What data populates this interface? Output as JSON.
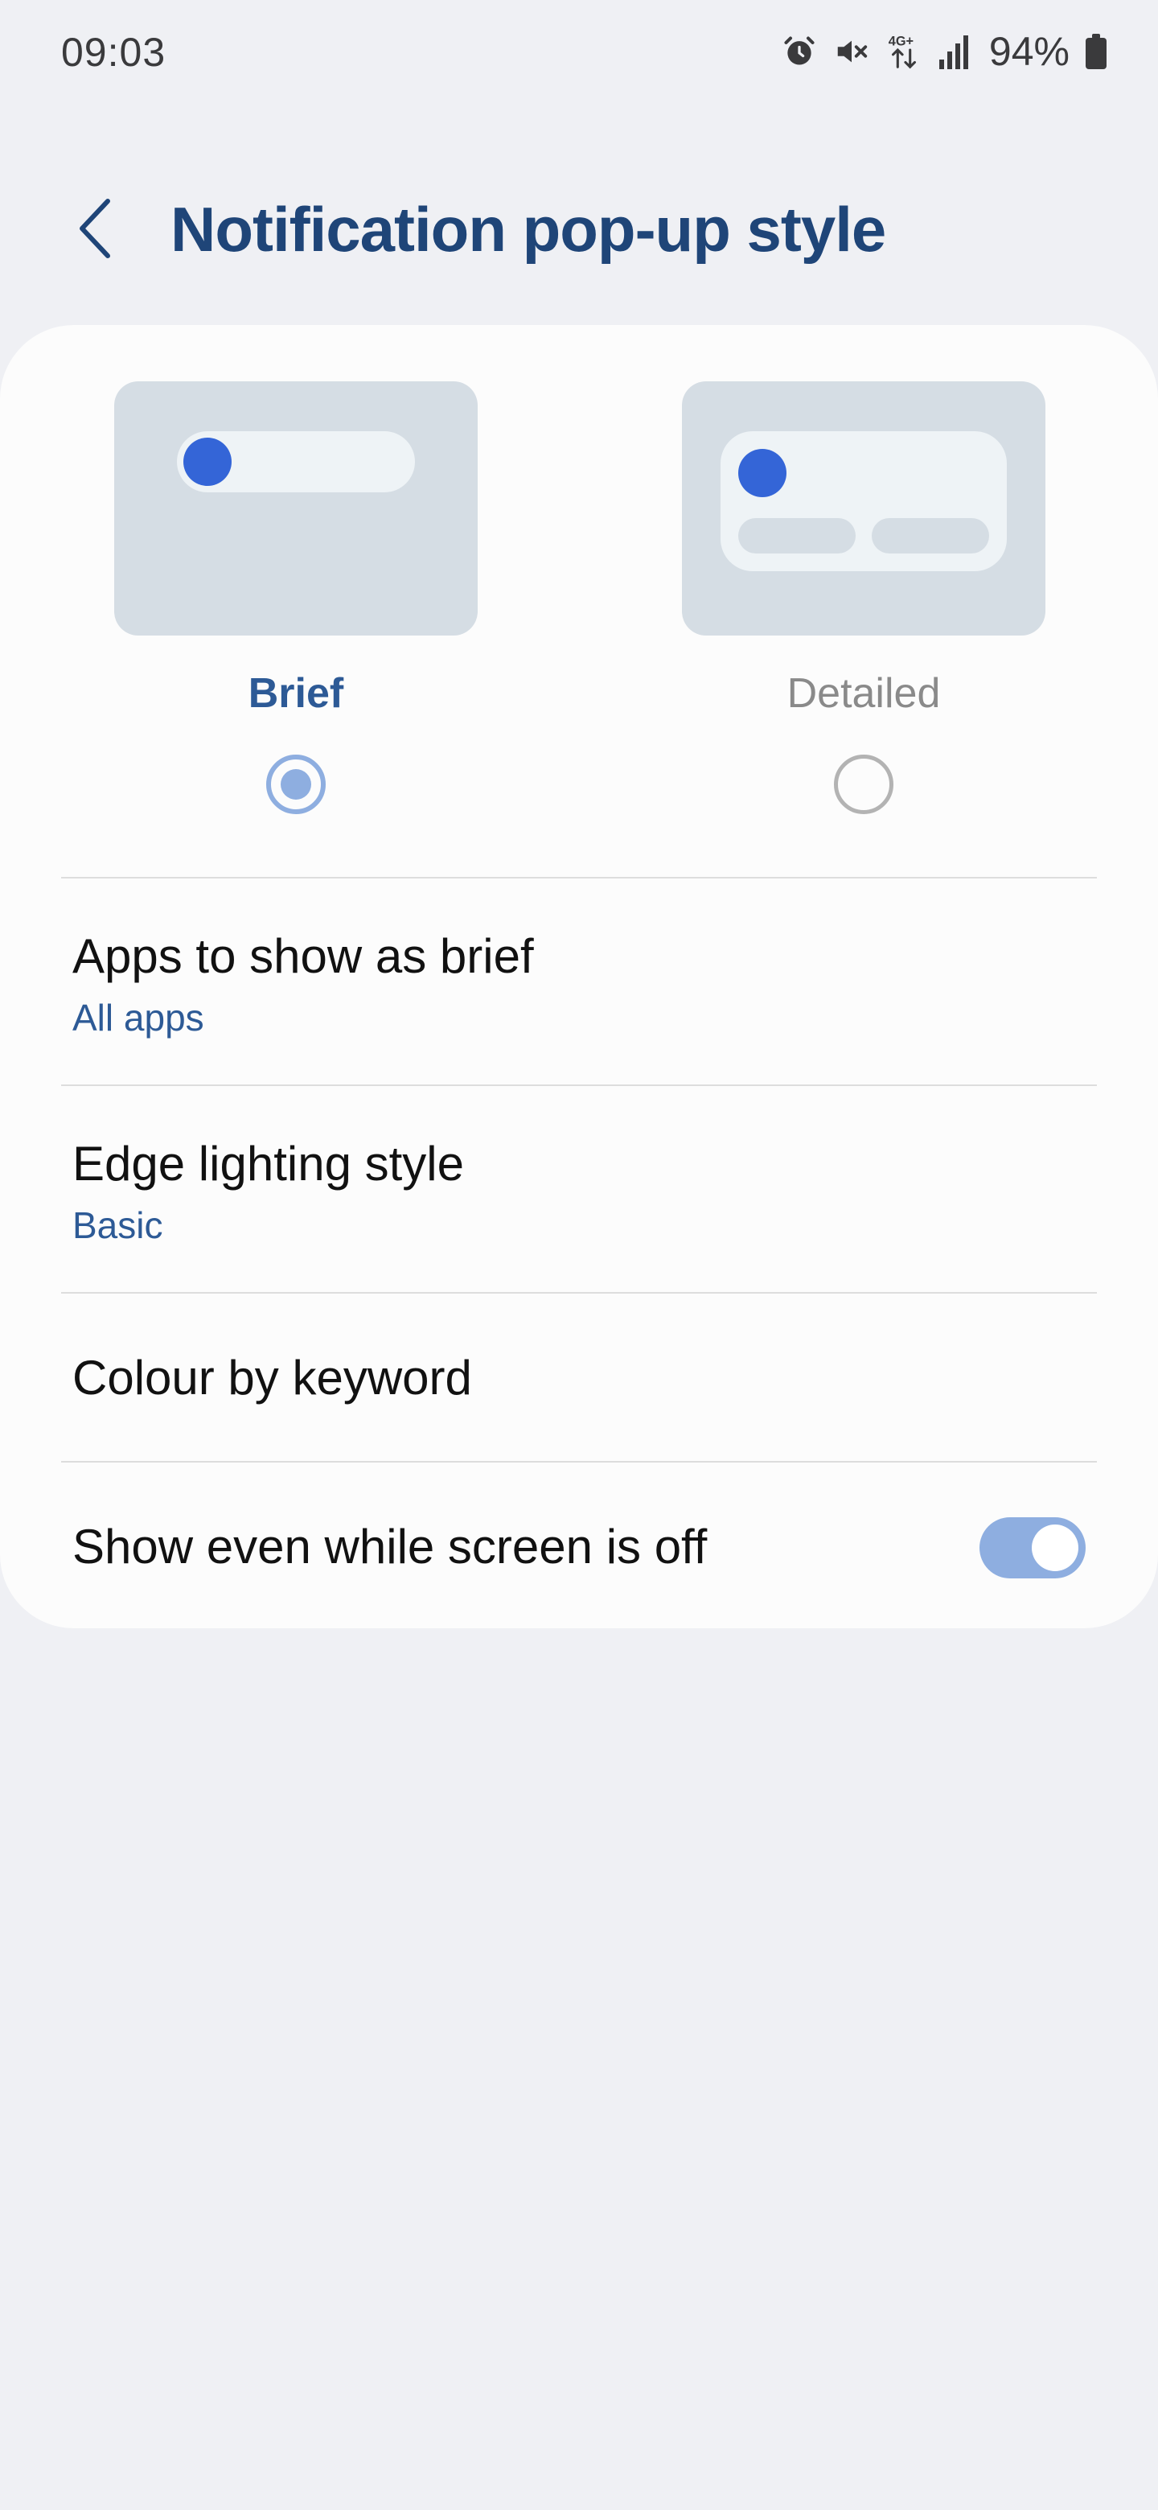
{
  "status_bar": {
    "time": "09:03",
    "battery_percent": "94%",
    "icons": [
      "alarm-icon",
      "mute-icon",
      "4g-plus-icon",
      "signal-icon",
      "battery-icon"
    ]
  },
  "header": {
    "title": "Notification pop-up style",
    "back_icon": "chevron-left-icon"
  },
  "styles": {
    "brief_label": "Brief",
    "detailed_label": "Detailed",
    "selected": "Brief"
  },
  "settings": {
    "apps_title": "Apps to show as brief",
    "apps_value": "All apps",
    "edge_title": "Edge lighting style",
    "edge_value": "Basic",
    "keyword_title": "Colour by keyword",
    "screen_off_title": "Show even while screen is off",
    "screen_off_enabled": true
  },
  "colors": {
    "accent": "#2d5a96",
    "title": "#1f4578",
    "toggle_on": "#8eaee0",
    "preview_dot": "#3465d7",
    "background": "#eff0f4",
    "card": "#fcfcfc"
  }
}
